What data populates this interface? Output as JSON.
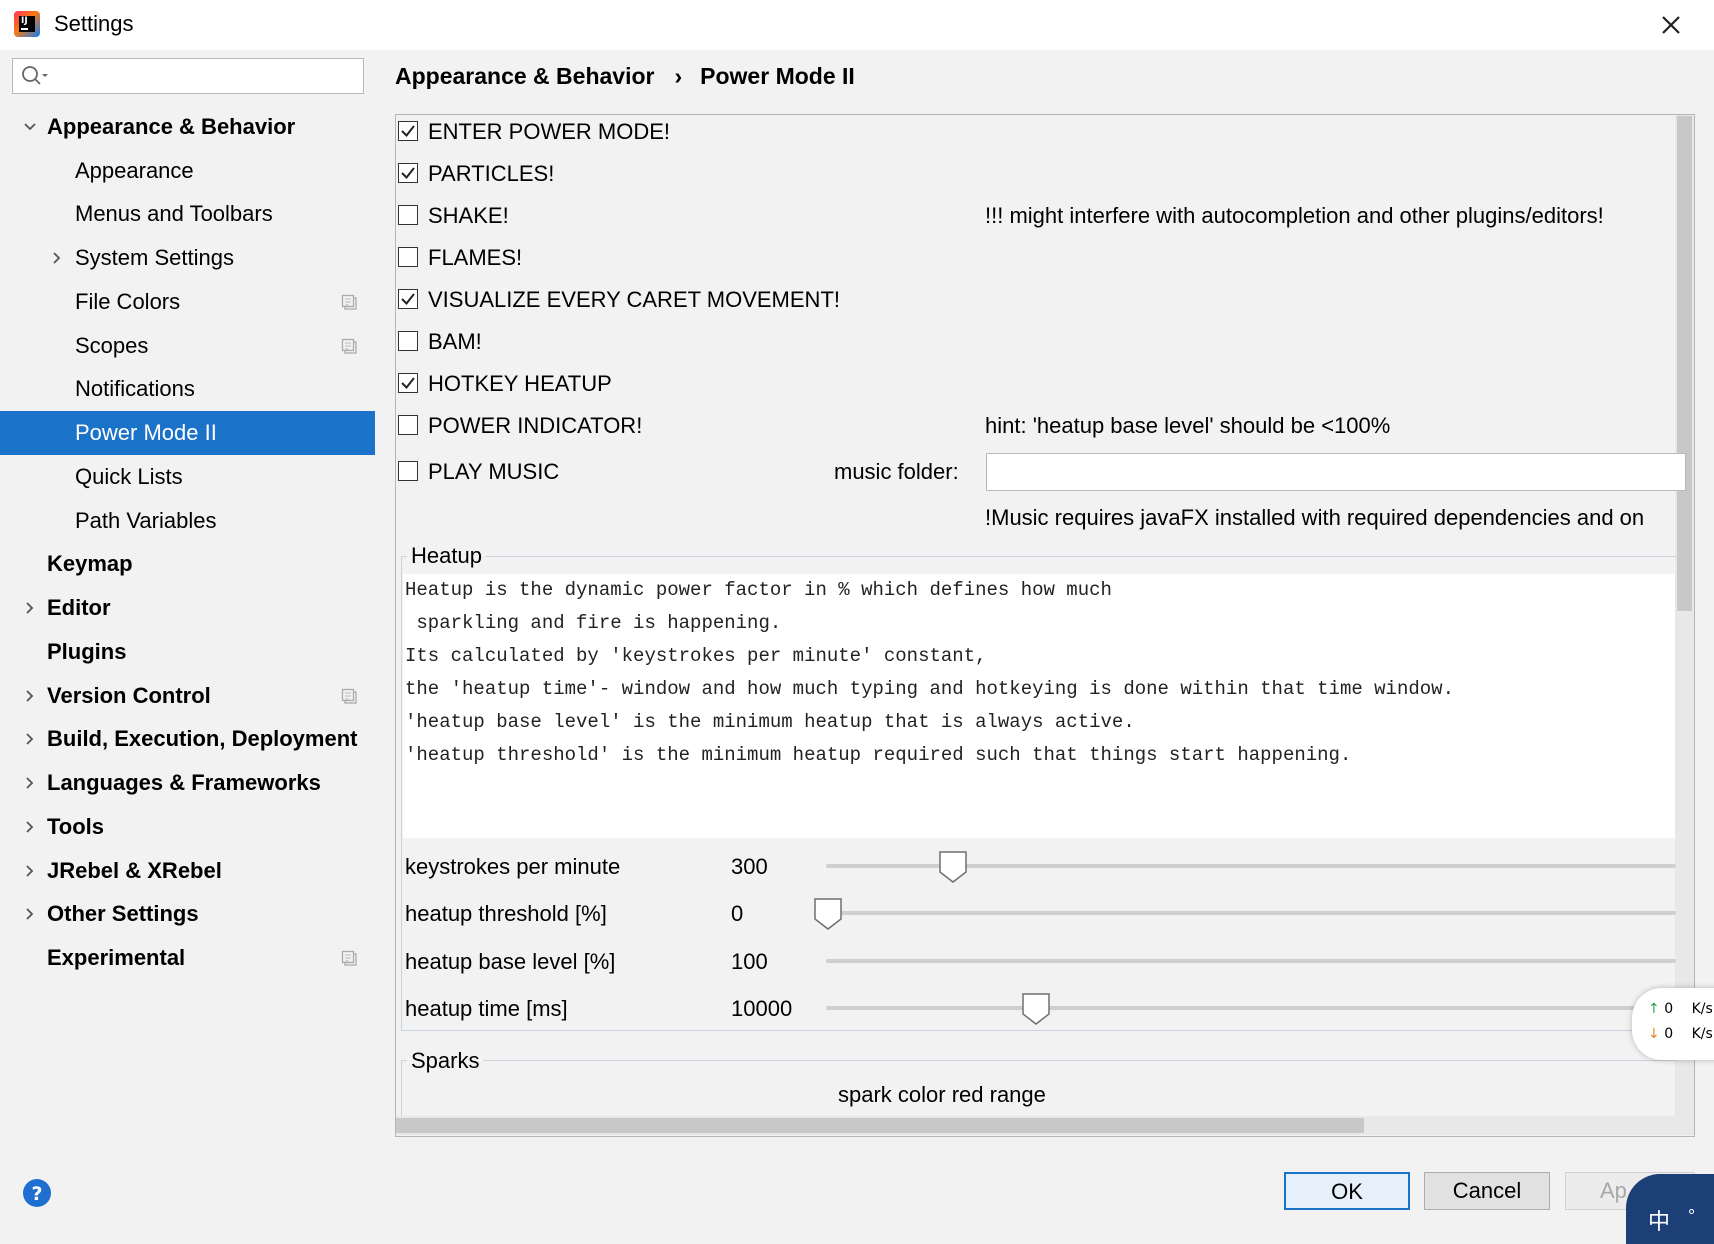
{
  "window": {
    "title": "Settings"
  },
  "search": {
    "placeholder": ""
  },
  "sidebar": {
    "items": [
      {
        "label": "Appearance & Behavior"
      },
      {
        "label": "Appearance"
      },
      {
        "label": "Menus and Toolbars"
      },
      {
        "label": "System Settings"
      },
      {
        "label": "File Colors"
      },
      {
        "label": "Scopes"
      },
      {
        "label": "Notifications"
      },
      {
        "label": "Power Mode II"
      },
      {
        "label": "Quick Lists"
      },
      {
        "label": "Path Variables"
      },
      {
        "label": "Keymap"
      },
      {
        "label": "Editor"
      },
      {
        "label": "Plugins"
      },
      {
        "label": "Version Control"
      },
      {
        "label": "Build, Execution, Deployment"
      },
      {
        "label": "Languages & Frameworks"
      },
      {
        "label": "Tools"
      },
      {
        "label": "JRebel & XRebel"
      },
      {
        "label": "Other Settings"
      },
      {
        "label": "Experimental"
      }
    ]
  },
  "breadcrumb": {
    "parent": "Appearance & Behavior",
    "separator": "›",
    "current": "Power Mode II"
  },
  "options": [
    {
      "label": "ENTER POWER MODE!",
      "checked": true
    },
    {
      "label": "PARTICLES!",
      "checked": true
    },
    {
      "label": "SHAKE!",
      "checked": false
    },
    {
      "label": "FLAMES!",
      "checked": false
    },
    {
      "label": "VISUALIZE EVERY CARET MOVEMENT!",
      "checked": true
    },
    {
      "label": "BAM!",
      "checked": false
    },
    {
      "label": "HOTKEY HEATUP",
      "checked": true
    },
    {
      "label": "POWER INDICATOR!",
      "checked": false
    },
    {
      "label": "PLAY MUSIC",
      "checked": false
    }
  ],
  "notes": {
    "shake_warning": "!!! might interfere with autocompletion and other plugins/editors!",
    "power_hint": "hint: 'heatup base level' should be <100%",
    "music_folder_label": "music folder:",
    "music_folder_value": "",
    "music_requirement": "!Music requires javaFX installed with required dependencies and on"
  },
  "heatup": {
    "title": "Heatup",
    "description": [
      "Heatup is the dynamic power factor in % which defines how much",
      " sparkling and fire is happening.",
      "Its calculated by 'keystrokes per minute' constant,",
      "the 'heatup time'- window and how much typing and hotkeying is done within that time window.",
      "'heatup base level' is the minimum heatup that is always active.",
      "'heatup threshold' is the minimum heatup required such that things start happening."
    ],
    "sliders": [
      {
        "label": "keystrokes per minute",
        "value": "300",
        "fraction": 0.147
      },
      {
        "label": "heatup threshold [%]",
        "value": "0",
        "fraction": 0.0
      },
      {
        "label": "heatup base level [%]",
        "value": "100",
        "fraction": 1.0
      },
      {
        "label": "heatup time [ms]",
        "value": "10000",
        "fraction": 0.245
      }
    ]
  },
  "sparks": {
    "title": "Sparks",
    "red_range_label": "spark color red range"
  },
  "network": {
    "up_value": "0",
    "up_unit": "K/s",
    "down_value": "0",
    "down_unit": "K/s"
  },
  "buttons": {
    "ok": "OK",
    "cancel": "Cancel",
    "apply": "Ap"
  },
  "ime": {
    "char": "中"
  },
  "colors": {
    "selection": "#1a73c8",
    "background": "#f2f2f2"
  }
}
